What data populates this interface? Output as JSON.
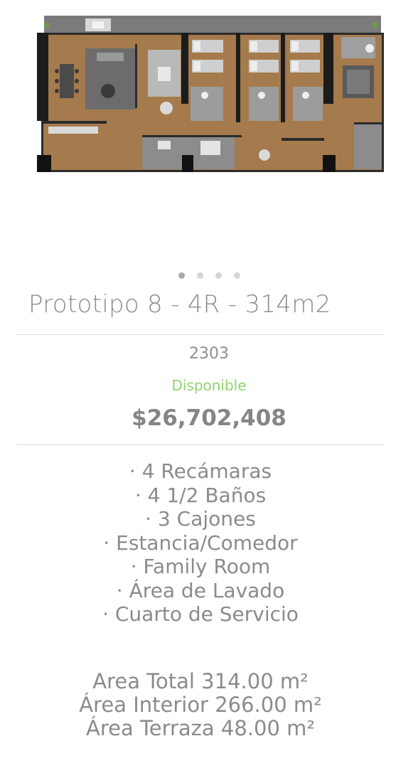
{
  "carousel": {
    "slide_count": 4,
    "active_index": 0
  },
  "property": {
    "title": "Prototipo 8 - 4R - 314m2",
    "unit_number": "2303",
    "status": "Disponible",
    "price": "$26,702,408"
  },
  "features": [
    "· 4 Recámaras",
    "· 4 1/2 Baños",
    "· 3 Cajones",
    "· Estancia/Comedor",
    "· Family Room",
    "· Área de Lavado",
    "· Cuarto de Servicio"
  ],
  "areas": [
    "Area Total 314.00 m²",
    "Área Interior 266.00 m²",
    "Área Terraza 48.00 m²"
  ],
  "colors": {
    "text_gray": "#8a8a8a",
    "status_green": "#8fd46e",
    "divider": "#dddddd",
    "floor_wood": "#a57a4c"
  }
}
